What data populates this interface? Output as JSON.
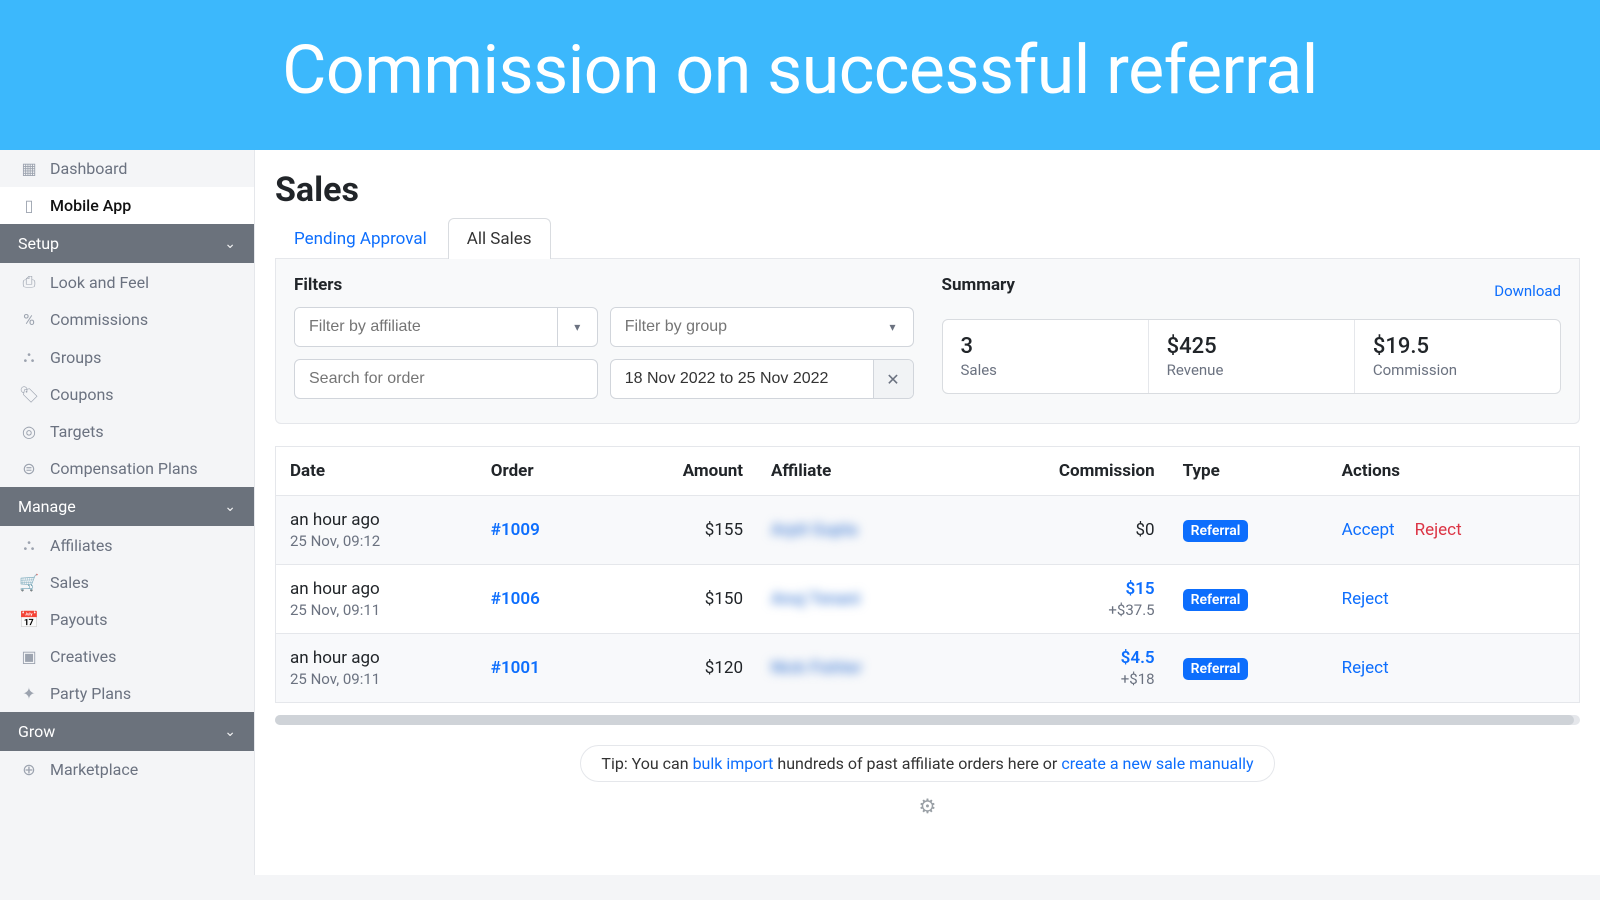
{
  "banner": "Commission on successful referral",
  "sidebar": {
    "dashboard": "Dashboard",
    "mobile": "Mobile App",
    "setup": "Setup",
    "look": "Look and Feel",
    "commissions": "Commissions",
    "groups": "Groups",
    "coupons": "Coupons",
    "targets": "Targets",
    "compplans": "Compensation Plans",
    "manage": "Manage",
    "affiliates": "Affiliates",
    "sales": "Sales",
    "payouts": "Payouts",
    "creatives": "Creatives",
    "party": "Party Plans",
    "grow": "Grow",
    "marketplace": "Marketplace"
  },
  "page": {
    "title": "Sales"
  },
  "tabs": {
    "pending": "Pending Approval",
    "all": "All Sales"
  },
  "filters": {
    "title": "Filters",
    "affiliate_ph": "Filter by affiliate",
    "group_ph": "Filter by group",
    "search_ph": "Search for order",
    "date_value": "18 Nov 2022 to 25 Nov 2022"
  },
  "summary": {
    "title": "Summary",
    "download": "Download",
    "cards": {
      "sales": {
        "value": "3",
        "label": "Sales"
      },
      "revenue": {
        "value": "$425",
        "label": "Revenue"
      },
      "commission": {
        "value": "$19.5",
        "label": "Commission"
      }
    }
  },
  "table": {
    "headers": {
      "date": "Date",
      "order": "Order",
      "amount": "Amount",
      "affiliate": "Affiliate",
      "commission": "Commission",
      "type": "Type",
      "actions": "Actions"
    },
    "rows": [
      {
        "ago": "an hour ago",
        "time": "25 Nov, 09:12",
        "order": "#1009",
        "amount": "$155",
        "affiliate": "Arpit Gupta",
        "commission": "$0",
        "comm_sub": "",
        "type": "Referral",
        "accept": "Accept",
        "reject": "Reject"
      },
      {
        "ago": "an hour ago",
        "time": "25 Nov, 09:11",
        "order": "#1006",
        "amount": "$150",
        "affiliate": "Anuj Tenani",
        "commission": "$15",
        "comm_sub": "+$37.5",
        "type": "Referral",
        "accept": "",
        "reject": "Reject"
      },
      {
        "ago": "an hour ago",
        "time": "25 Nov, 09:11",
        "order": "#1001",
        "amount": "$120",
        "affiliate": "Nick Fishter",
        "commission": "$4.5",
        "comm_sub": "+$18",
        "type": "Referral",
        "accept": "",
        "reject": "Reject"
      }
    ]
  },
  "tip": {
    "pre": "Tip: You can ",
    "bulk": "bulk import",
    "mid": " hundreds of past affiliate orders here or ",
    "create": "create a new sale manually"
  }
}
